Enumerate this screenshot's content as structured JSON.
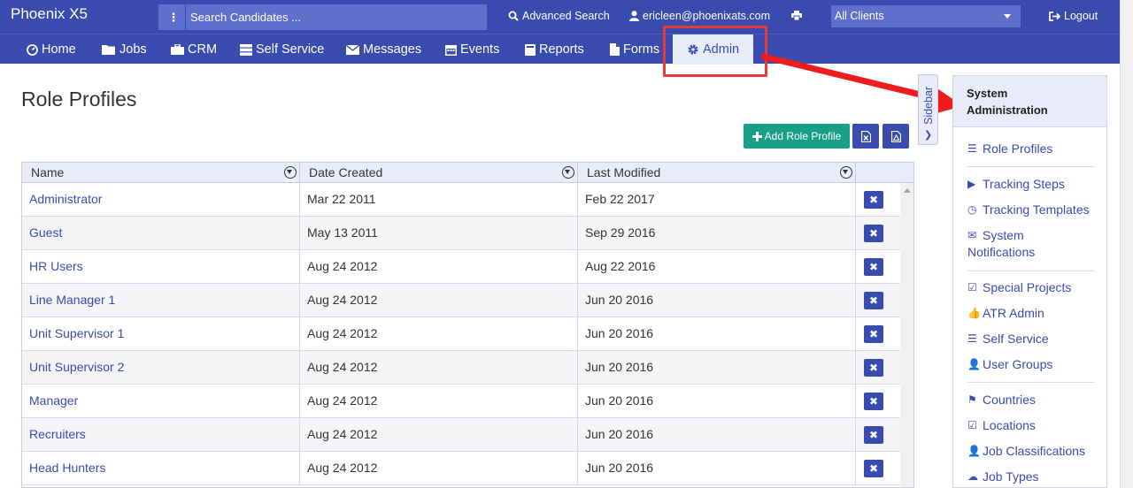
{
  "app": {
    "brand": "Phoenix X5"
  },
  "topbar": {
    "search_placeholder": "Search Candidates ...",
    "advanced_search": "Advanced Search",
    "user_email": "ericleen@phoenixats.com",
    "client_select": "All Clients",
    "logout": "Logout"
  },
  "nav": {
    "items": [
      "Home",
      "Jobs",
      "CRM",
      "Self Service",
      "Messages",
      "Events",
      "Reports",
      "Forms",
      "Admin"
    ],
    "active": "Admin"
  },
  "page": {
    "title": "Role Profiles",
    "add_button": "Add Role Profile",
    "sidebar_tab": "Sidebar"
  },
  "grid": {
    "columns": [
      "Name",
      "Date Created",
      "Last Modified"
    ],
    "rows": [
      {
        "name": "Administrator",
        "created": "Mar 22 2011",
        "modified": "Feb 22 2017"
      },
      {
        "name": "Guest",
        "created": "May 13 2011",
        "modified": "Sep 29 2016"
      },
      {
        "name": "HR Users",
        "created": "Aug 24 2012",
        "modified": "Aug 22 2016"
      },
      {
        "name": "Line Manager 1",
        "created": "Aug 24 2012",
        "modified": "Jun 20 2016"
      },
      {
        "name": "Unit Supervisor 1",
        "created": "Aug 24 2012",
        "modified": "Jun 20 2016"
      },
      {
        "name": "Unit Supervisor 2",
        "created": "Aug 24 2012",
        "modified": "Jun 20 2016"
      },
      {
        "name": "Manager",
        "created": "Aug 24 2012",
        "modified": "Jun 20 2016"
      },
      {
        "name": "Recruiters",
        "created": "Aug 24 2012",
        "modified": "Jun 20 2016"
      },
      {
        "name": "Head Hunters",
        "created": "Aug 24 2012",
        "modified": "Jun 20 2016"
      }
    ]
  },
  "panel": {
    "title_line1": "System",
    "title_line2": "Administration",
    "links": {
      "role_profiles": "Role Profiles",
      "tracking_steps": "Tracking Steps",
      "tracking_templates": "Tracking Templates",
      "system_notifications_1": "System",
      "system_notifications_2": "Notifications",
      "special_projects": "Special Projects",
      "atr_admin": "ATR Admin",
      "self_service": "Self Service",
      "user_groups": "User Groups",
      "countries": "Countries",
      "locations": "Locations",
      "job_classifications": "Job Classifications",
      "job_types": "Job Types"
    }
  },
  "colors": {
    "primary": "#3a4bb0",
    "success": "#17a085",
    "highlight": "#e53b3b"
  }
}
